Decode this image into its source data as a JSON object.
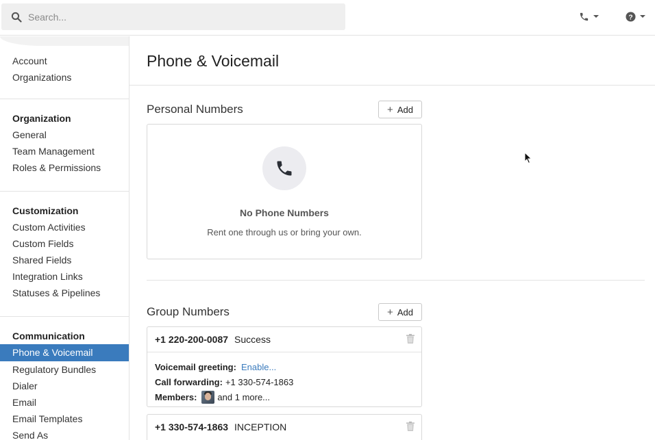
{
  "search": {
    "placeholder": "Search..."
  },
  "sidebar": {
    "top_items": [
      {
        "label": "Account"
      },
      {
        "label": "Organizations"
      }
    ],
    "organization": {
      "heading": "Organization",
      "items": [
        {
          "label": "General"
        },
        {
          "label": "Team Management"
        },
        {
          "label": "Roles & Permissions"
        }
      ]
    },
    "customization": {
      "heading": "Customization",
      "items": [
        {
          "label": "Custom Activities"
        },
        {
          "label": "Custom Fields"
        },
        {
          "label": "Shared Fields"
        },
        {
          "label": "Integration Links"
        },
        {
          "label": "Statuses & Pipelines"
        }
      ]
    },
    "communication": {
      "heading": "Communication",
      "items": [
        {
          "label": "Phone & Voicemail",
          "active": true
        },
        {
          "label": "Regulatory Bundles"
        },
        {
          "label": "Dialer"
        },
        {
          "label": "Email"
        },
        {
          "label": "Email Templates"
        },
        {
          "label": "Send As"
        }
      ]
    }
  },
  "main": {
    "title": "Phone & Voicemail",
    "personal": {
      "title": "Personal Numbers",
      "add_label": "Add",
      "empty_title": "No Phone Numbers",
      "empty_text": "Rent one through us or bring your own."
    },
    "group": {
      "title": "Group Numbers",
      "add_label": "Add",
      "numbers": [
        {
          "number": "+1 220-200-0087",
          "name": "Success",
          "voicemail_label": "Voicemail greeting:",
          "voicemail_value": "Enable...",
          "forwarding_label": "Call forwarding:",
          "forwarding_value": "+1 330-574-1863",
          "members_label": "Members:",
          "members_more": "and 1 more..."
        },
        {
          "number": "+1 330-574-1863",
          "name": "INCEPTION"
        }
      ]
    }
  },
  "colors": {
    "accent": "#3a7bbd",
    "active_bg": "#3a7bbd",
    "border": "#d8d8d8"
  },
  "icons": [
    "search-icon",
    "phone-icon",
    "help-icon",
    "chevron-down-icon",
    "plus-icon",
    "trash-icon"
  ]
}
